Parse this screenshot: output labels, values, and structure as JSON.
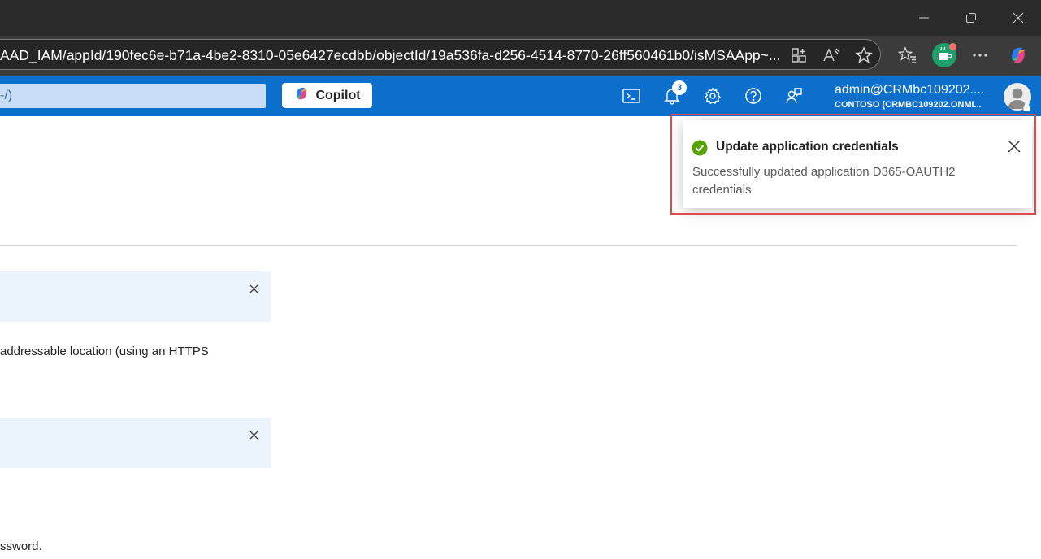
{
  "browser": {
    "url": "AAD_IAM/appId/190fec6e-b71a-4be2-8310-05e6427ecdbb/objectId/19a536fa-d256-4514-8770-26ff560461b0/isMSAApp~...",
    "icons": [
      "minimize-icon",
      "restore-icon",
      "close-icon",
      "app-available-icon",
      "read-aloud-icon",
      "favorite-star-icon",
      "favorites-icon",
      "profile-icon",
      "more-icon",
      "copilot-icon"
    ]
  },
  "header": {
    "search_text": "-/)",
    "copilot_label": "Copilot",
    "notification_count": "3",
    "username": "admin@CRMbc109202....",
    "tenant": "CONTOSO (CRMBC109202.ONMI...",
    "icons": [
      "cloud-shell-icon",
      "notifications-icon",
      "settings-icon",
      "help-icon",
      "feedback-icon"
    ]
  },
  "content": {
    "text_line_1": "addressable location (using an HTTPS",
    "text_line_2": "ssword."
  },
  "toast": {
    "title": "Update application credentials",
    "message": "Successfully updated application D365-OAUTH2 credentials",
    "status_color": "#57a300"
  },
  "colors": {
    "azure_header": "#0b6fcb",
    "highlight": "#e04a4a"
  }
}
